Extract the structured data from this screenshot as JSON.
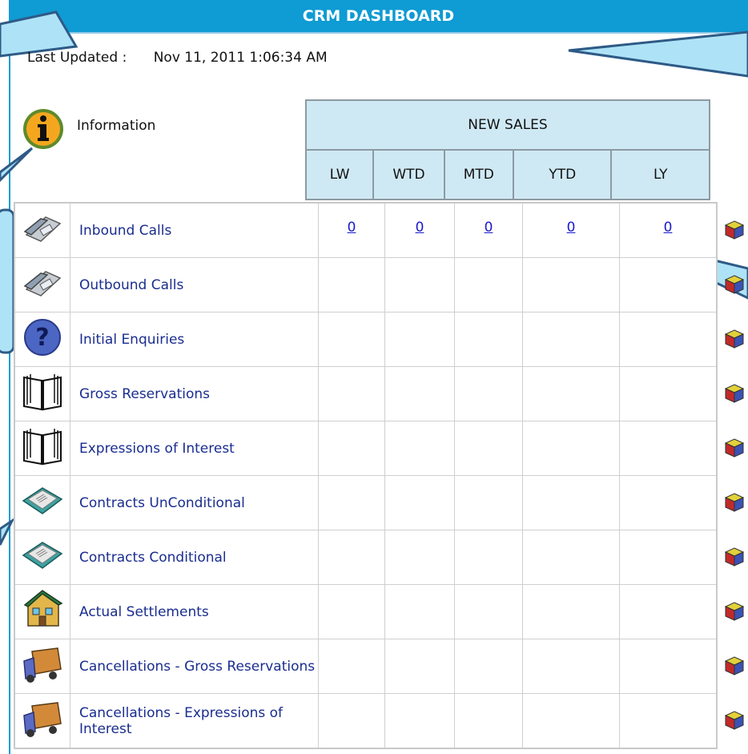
{
  "app": {
    "title": "CRM DASHBOARD"
  },
  "status": {
    "last_updated_label": "Last Updated :",
    "last_updated_value": "Nov 11, 2011 1:06:34 AM"
  },
  "info": {
    "label": "Information"
  },
  "table": {
    "group_header": "NEW SALES",
    "columns": [
      "LW",
      "WTD",
      "MTD",
      "YTD",
      "LY"
    ],
    "rows": [
      {
        "label": "Inbound Calls",
        "icon": "telephone-icon",
        "values": [
          "0",
          "0",
          "0",
          "0",
          "0"
        ]
      },
      {
        "label": "Outbound Calls",
        "icon": "telephone-icon",
        "values": [
          "",
          "",
          "",
          "",
          ""
        ]
      },
      {
        "label": "Initial Enquiries",
        "icon": "help-icon",
        "values": [
          "",
          "",
          "",
          "",
          ""
        ]
      },
      {
        "label": "Gross Reservations",
        "icon": "book-icon",
        "values": [
          "",
          "",
          "",
          "",
          ""
        ]
      },
      {
        "label": "Expressions of Interest",
        "icon": "book-icon",
        "values": [
          "",
          "",
          "",
          "",
          ""
        ]
      },
      {
        "label": "Contracts UnConditional",
        "icon": "contract-icon",
        "values": [
          "",
          "",
          "",
          "",
          ""
        ]
      },
      {
        "label": "Contracts Conditional",
        "icon": "contract-icon",
        "values": [
          "",
          "",
          "",
          "",
          ""
        ]
      },
      {
        "label": "Actual Settlements",
        "icon": "house-icon",
        "values": [
          "",
          "",
          "",
          "",
          ""
        ]
      },
      {
        "label": "Cancellations - Gross Reservations",
        "icon": "truck-icon",
        "values": [
          "",
          "",
          "",
          "",
          ""
        ]
      },
      {
        "label": "Cancellations - Expressions of Interest",
        "icon": "truck-icon",
        "values": [
          "",
          "",
          "",
          "",
          ""
        ]
      }
    ]
  },
  "colors": {
    "banner": "#0f9bd3",
    "header_bg": "#cfe9f4",
    "link": "#1a1acc",
    "label": "#1a2d8f"
  }
}
